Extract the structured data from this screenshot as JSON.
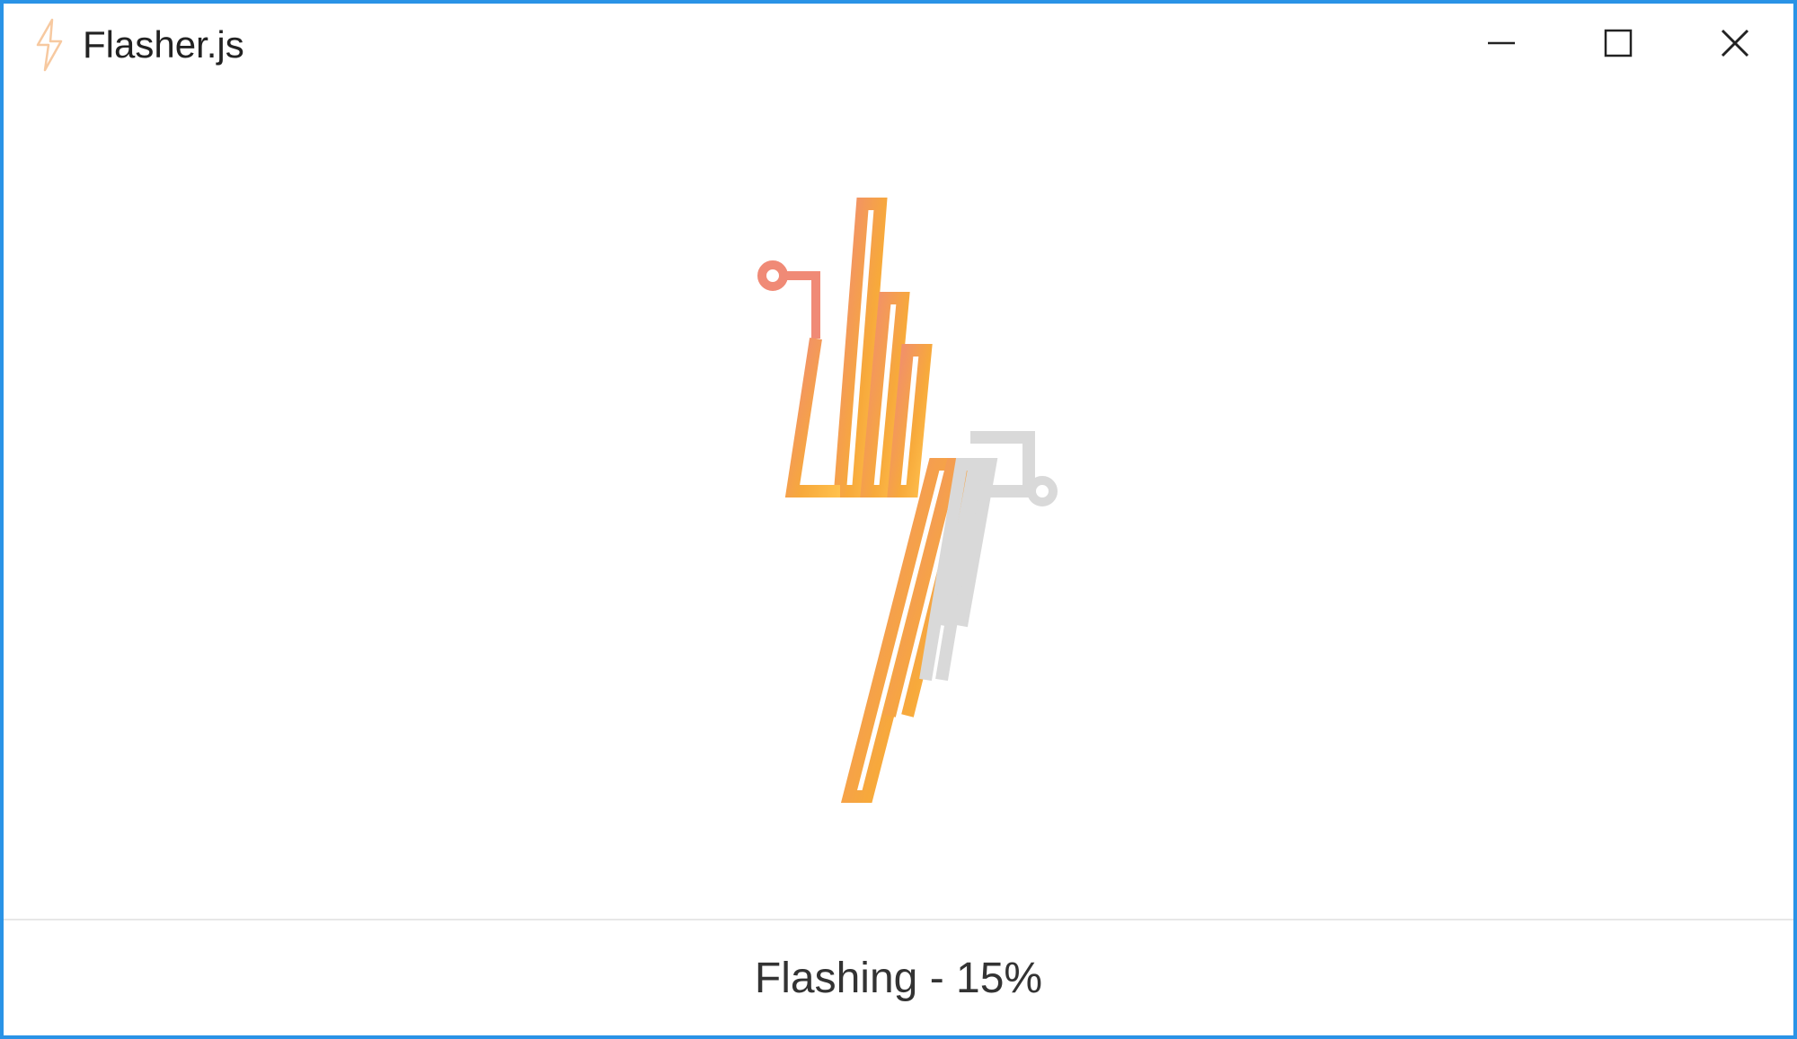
{
  "titlebar": {
    "app_title": "Flasher.js"
  },
  "status": {
    "label": "Flashing - 15%",
    "percent": 15
  },
  "colors": {
    "accent_orange": "#f7a93b",
    "accent_coral": "#f08a76",
    "muted": "#d9d9d9",
    "window_border": "#2a93e6"
  }
}
